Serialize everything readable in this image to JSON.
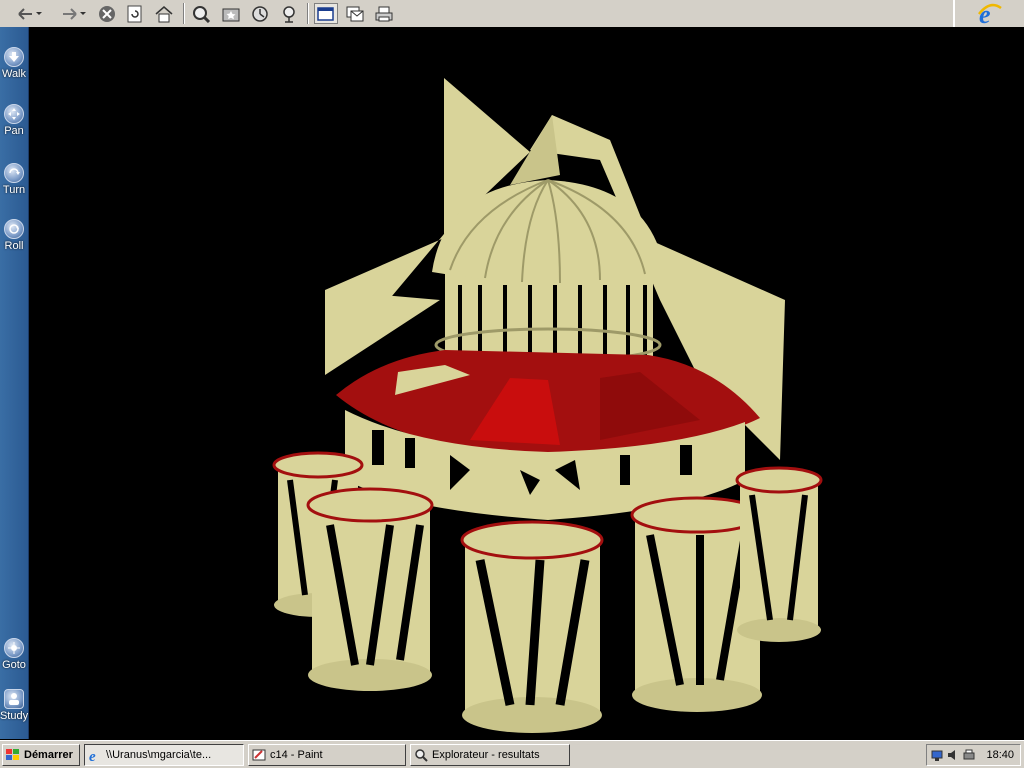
{
  "toolbar": {
    "buttons": [
      {
        "name": "back-button",
        "icon": "arrow-left-icon"
      },
      {
        "name": "forward-button",
        "icon": "arrow-right-icon"
      },
      {
        "name": "stop-button",
        "icon": "stop-icon"
      },
      {
        "name": "refresh-button",
        "icon": "refresh-icon"
      },
      {
        "name": "home-button",
        "icon": "home-icon"
      },
      {
        "name": "search-button",
        "icon": "search-icon"
      },
      {
        "name": "favorites-button",
        "icon": "favorites-icon"
      },
      {
        "name": "history-button",
        "icon": "history-icon"
      },
      {
        "name": "channels-button",
        "icon": "channels-icon"
      },
      {
        "name": "fullscreen-button",
        "icon": "fullscreen-icon"
      },
      {
        "name": "mail-button",
        "icon": "mail-icon"
      },
      {
        "name": "print-button",
        "icon": "print-icon"
      }
    ],
    "brand_icon": "ie-logo-icon"
  },
  "nav": {
    "walk": "Walk",
    "pan": "Pan",
    "turn": "Turn",
    "roll": "Roll",
    "goto": "Goto",
    "study": "Study"
  },
  "scene": {
    "colors": {
      "background": "#000000",
      "stone": "#d9d49a",
      "stone_shadow": "#9e9a68",
      "roof": "#a30f0f",
      "roof_dark": "#6e0808"
    }
  },
  "taskbar": {
    "start_label": "Démarrer",
    "tasks": [
      {
        "label": "\\\\Uranus\\mgarcia\\te...",
        "icon": "ie-icon",
        "active": true
      },
      {
        "label": "c14 - Paint",
        "icon": "paint-icon",
        "active": false
      },
      {
        "label": "Explorateur - resultats",
        "icon": "explorer-icon",
        "active": false
      }
    ],
    "clock": "18:40"
  }
}
